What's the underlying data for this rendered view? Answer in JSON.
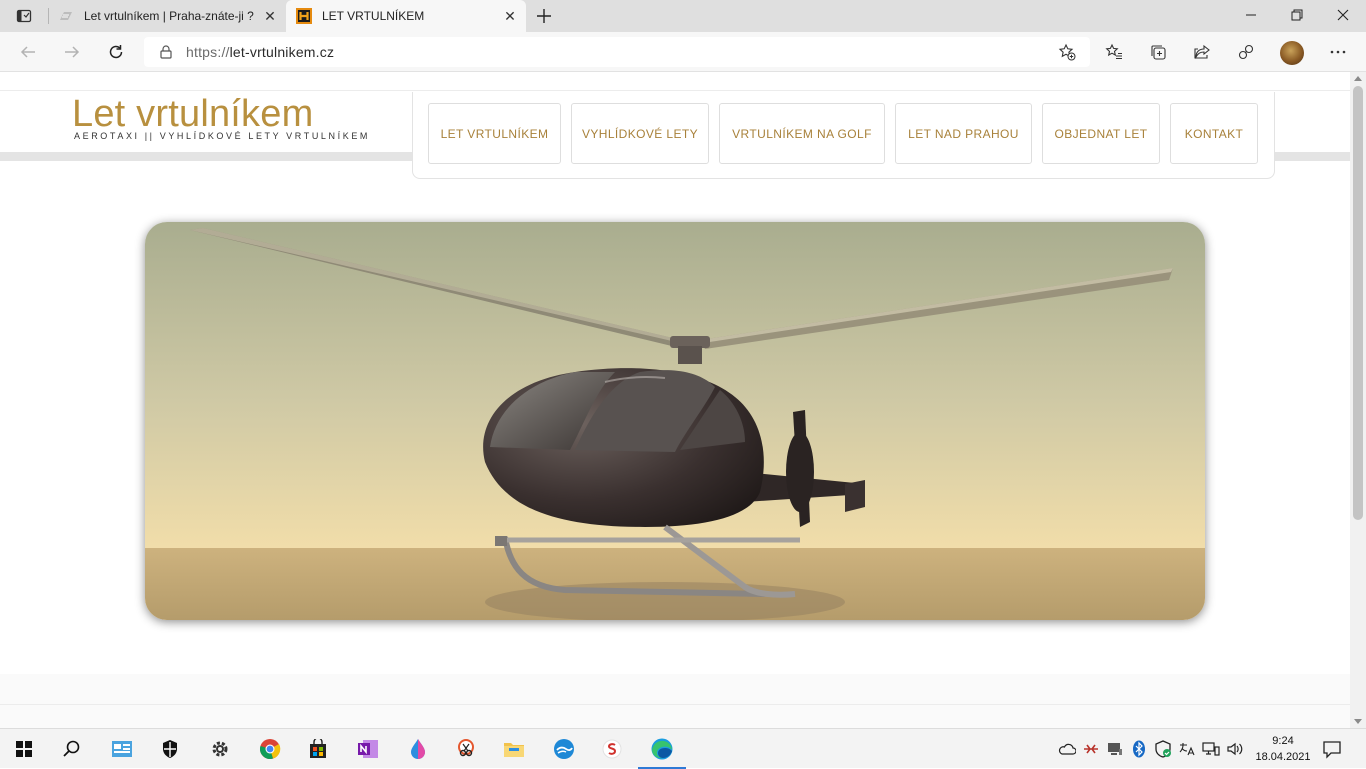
{
  "browser": {
    "tabs": [
      {
        "title": "Let vrtulníkem | Praha-znáte-ji ?",
        "active": false
      },
      {
        "title": "LET VRTULNÍKEM",
        "active": true
      }
    ],
    "url_protocol": "https://",
    "url_host": "let-vrtulnikem.cz"
  },
  "site": {
    "logo_title": "Let vrtulníkem",
    "logo_subtitle": "AEROTAXI || VYHLÍDKOVÉ LETY VRTULNÍKEM",
    "menu": [
      "LET VRTULNÍKEM",
      "VYHLÍDKOVÉ LETY",
      "VRTULNÍKEM NA GOLF",
      "LET NAD PRAHOU",
      "OBJEDNAT LET",
      "KONTAKT"
    ],
    "accent_color": "#b8903f"
  },
  "taskbar": {
    "apps": [
      "start-icon",
      "search-icon",
      "widget-icon",
      "security-icon",
      "settings-icon",
      "chrome-icon",
      "store-icon",
      "onenote-icon",
      "paint-icon",
      "snip-icon",
      "explorer-icon",
      "weather-icon",
      "app-s-icon",
      "edge-icon"
    ],
    "time": "9:24",
    "date": "18.04.2021"
  }
}
